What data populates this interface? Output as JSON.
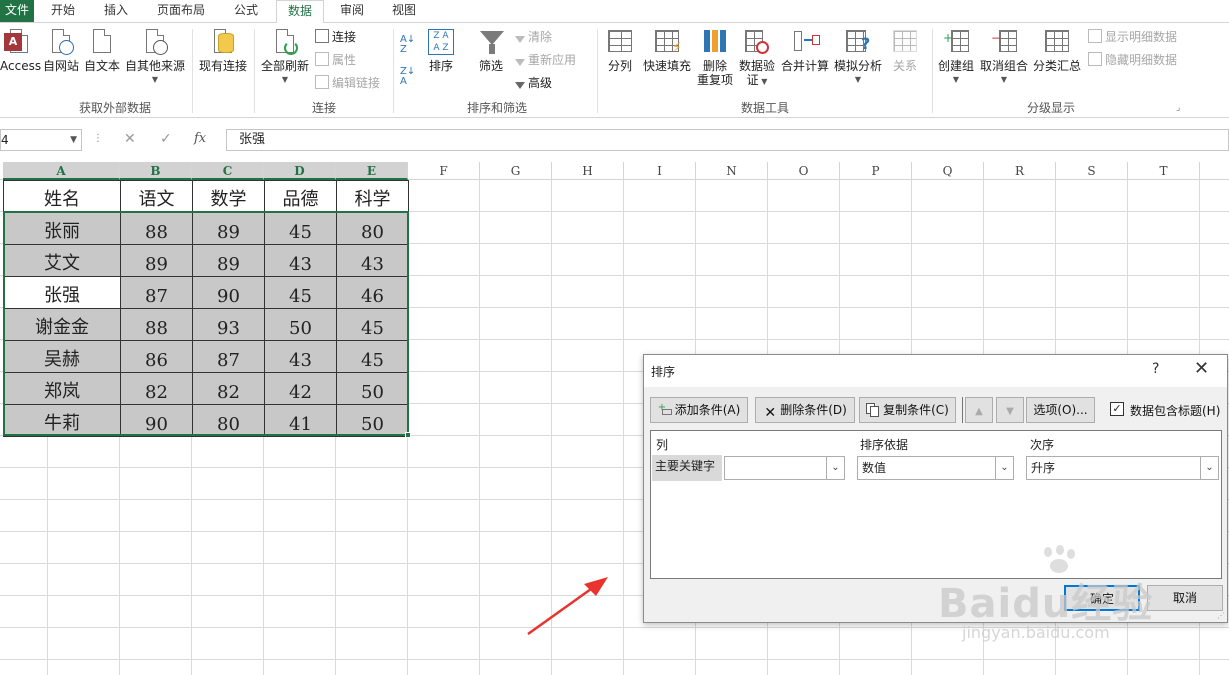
{
  "tabs": {
    "file": "文件",
    "home": "开始",
    "insert": "插入",
    "layout": "页面布局",
    "formulas": "公式",
    "data": "数据",
    "review": "审阅",
    "view": "视图"
  },
  "ribbon": {
    "external": {
      "access": "Access",
      "web": "自网站",
      "text": "自文本",
      "other": "自其他来源",
      "existing": "现有连接",
      "group_label": "获取外部数据"
    },
    "connections": {
      "refresh_all": "全部刷新",
      "connections": "连接",
      "properties": "属性",
      "edit_links": "编辑链接",
      "group_label": "连接"
    },
    "sort_filter": {
      "sort": "排序",
      "filter": "筛选",
      "clear": "清除",
      "reapply": "重新应用",
      "advanced": "高级",
      "group_label": "排序和筛选"
    },
    "data_tools": {
      "text_to_columns": "分列",
      "flash_fill": "快速填充",
      "remove_dup_1": "删除",
      "remove_dup_2": "重复项",
      "validation_1": "数据验",
      "validation_2": "证",
      "consolidate": "合并计算",
      "what_if": "模拟分析",
      "relationships": "关系",
      "group_label": "数据工具"
    },
    "outline": {
      "group": "创建组",
      "ungroup": "取消组合",
      "subtotal": "分类汇总",
      "show_detail": "显示明细数据",
      "hide_detail": "隐藏明细数据",
      "group_label": "分级显示"
    }
  },
  "formula_bar": {
    "name_box": "4",
    "fx": "fx",
    "cancel": "✕",
    "enter": "✓",
    "value": "张强"
  },
  "columns": [
    "A",
    "B",
    "C",
    "D",
    "E",
    "F",
    "G",
    "H",
    "I",
    "N",
    "O",
    "P",
    "Q",
    "R",
    "S",
    "T"
  ],
  "sheet": {
    "headers": [
      "姓名",
      "语文",
      "数学",
      "品德",
      "科学"
    ],
    "rows": [
      [
        "张丽",
        "88",
        "89",
        "45",
        "80"
      ],
      [
        "艾文",
        "89",
        "89",
        "43",
        "43"
      ],
      [
        "张强",
        "87",
        "90",
        "45",
        "46"
      ],
      [
        "谢金金",
        "88",
        "93",
        "50",
        "45"
      ],
      [
        "吴赫",
        "86",
        "87",
        "43",
        "45"
      ],
      [
        "郑岚",
        "82",
        "82",
        "42",
        "50"
      ],
      [
        "牛莉",
        "90",
        "80",
        "41",
        "50"
      ]
    ]
  },
  "dialog": {
    "title": "排序",
    "help": "?",
    "close": "✕",
    "add_level": "添加条件(A)",
    "delete_level": "删除条件(D)",
    "copy_level": "复制条件(C)",
    "options": "选项(O)...",
    "has_headers": "数据包含标题(H)",
    "col_header": "列",
    "sort_on_header": "排序依据",
    "order_header": "次序",
    "row_label": "主要关键字",
    "column_value": "",
    "sort_on_value": "数值",
    "order_value": "升序",
    "ok": "确定",
    "cancel": "取消"
  },
  "watermark": {
    "brand": "Baidu经验",
    "url": "jingyan.baidu.com"
  }
}
